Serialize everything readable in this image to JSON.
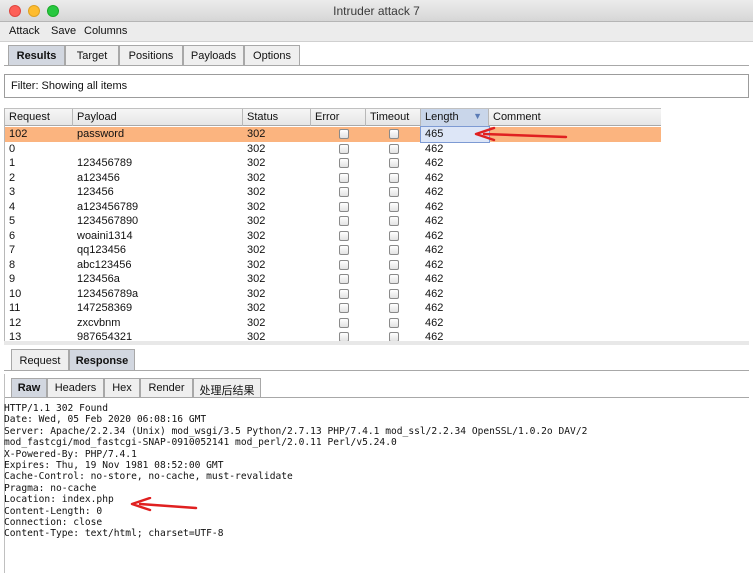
{
  "window": {
    "title": "Intruder attack 7"
  },
  "menu": [
    "Attack",
    "Save",
    "Columns"
  ],
  "top_tabs": [
    {
      "label": "Results",
      "active": true
    },
    {
      "label": "Target",
      "active": false
    },
    {
      "label": "Positions",
      "active": false
    },
    {
      "label": "Payloads",
      "active": false
    },
    {
      "label": "Options",
      "active": false
    }
  ],
  "filter": {
    "text": "Filter: Showing all items"
  },
  "table": {
    "columns": [
      "Request",
      "Payload",
      "Status",
      "Error",
      "Timeout",
      "Length",
      "Comment"
    ],
    "sorted_column": "Length",
    "rows": [
      {
        "request": "102",
        "payload": "password",
        "status": "302",
        "length": "465",
        "selected": true
      },
      {
        "request": "0",
        "payload": "",
        "status": "302",
        "length": "462"
      },
      {
        "request": "1",
        "payload": "123456789",
        "status": "302",
        "length": "462"
      },
      {
        "request": "2",
        "payload": "a123456",
        "status": "302",
        "length": "462"
      },
      {
        "request": "3",
        "payload": "123456",
        "status": "302",
        "length": "462"
      },
      {
        "request": "4",
        "payload": "a123456789",
        "status": "302",
        "length": "462"
      },
      {
        "request": "5",
        "payload": "1234567890",
        "status": "302",
        "length": "462"
      },
      {
        "request": "6",
        "payload": "woaini1314",
        "status": "302",
        "length": "462"
      },
      {
        "request": "7",
        "payload": "qq123456",
        "status": "302",
        "length": "462"
      },
      {
        "request": "8",
        "payload": "abc123456",
        "status": "302",
        "length": "462"
      },
      {
        "request": "9",
        "payload": "123456a",
        "status": "302",
        "length": "462"
      },
      {
        "request": "10",
        "payload": "123456789a",
        "status": "302",
        "length": "462"
      },
      {
        "request": "11",
        "payload": "147258369",
        "status": "302",
        "length": "462"
      },
      {
        "request": "12",
        "payload": "zxcvbnm",
        "status": "302",
        "length": "462"
      },
      {
        "request": "13",
        "payload": "987654321",
        "status": "302",
        "length": "462"
      }
    ]
  },
  "mid_tabs": [
    {
      "label": "Request",
      "active": false
    },
    {
      "label": "Response",
      "active": true
    }
  ],
  "sub_tabs": [
    {
      "label": "Raw",
      "active": true
    },
    {
      "label": "Headers",
      "active": false
    },
    {
      "label": "Hex",
      "active": false
    },
    {
      "label": "Render",
      "active": false
    },
    {
      "label": "处理后结果",
      "active": false
    }
  ],
  "response_lines": [
    "HTTP/1.1 302 Found",
    "Date: Wed, 05 Feb 2020 06:08:16 GMT",
    "Server: Apache/2.2.34 (Unix) mod_wsgi/3.5 Python/2.7.13 PHP/7.4.1 mod_ssl/2.2.34 OpenSSL/1.0.2o DAV/2",
    "mod_fastcgi/mod_fastcgi-SNAP-0910052141 mod_perl/2.0.11 Perl/v5.24.0",
    "X-Powered-By: PHP/7.4.1",
    "Expires: Thu, 19 Nov 1981 08:52:00 GMT",
    "Cache-Control: no-store, no-cache, must-revalidate",
    "Pragma: no-cache",
    "Location: index.php",
    "Content-Length: 0",
    "Connection: close",
    "Content-Type: text/html; charset=UTF-8"
  ],
  "colors": {
    "selected_row": "#fbb47f",
    "annotation_arrow": "#e02020",
    "active_tab": "#d2d7e0"
  }
}
